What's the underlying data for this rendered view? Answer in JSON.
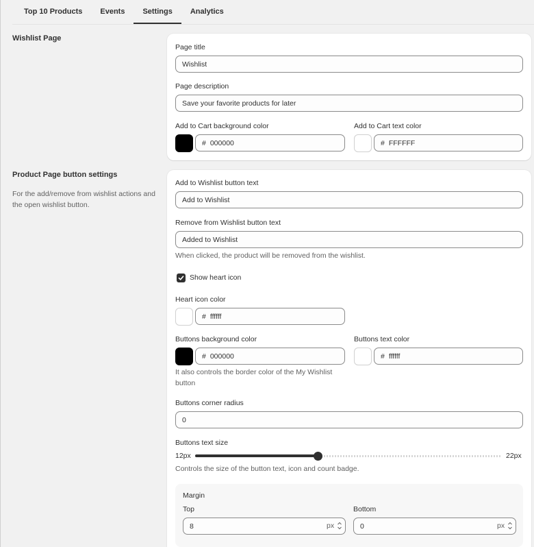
{
  "tabs": [
    {
      "label": "Top 10 Products"
    },
    {
      "label": "Events"
    },
    {
      "label": "Settings"
    },
    {
      "label": "Analytics"
    }
  ],
  "wishlist_page": {
    "title": "Wishlist Page",
    "page_title_label": "Page title",
    "page_title_value": "Wishlist",
    "page_desc_label": "Page description",
    "page_desc_value": "Save your favorite products for later",
    "cart_bg_label": "Add to Cart background color",
    "cart_bg_hash": "#",
    "cart_bg_value": "000000",
    "cart_text_label": "Add to Cart text color",
    "cart_text_hash": "#",
    "cart_text_value": "FFFFFF"
  },
  "product_page": {
    "title": "Product Page button settings",
    "description": "For the add/remove from wishlist actions and the open wishlist button.",
    "add_text_label": "Add to Wishlist button text",
    "add_text_value": "Add to Wishlist",
    "remove_text_label": "Remove from Wishlist button text",
    "remove_text_value": "Added to Wishlist",
    "remove_help": "When clicked, the product will be removed from the wishlist.",
    "show_heart_label": "Show heart icon",
    "show_heart_checked": true,
    "heart_color_label": "Heart icon color",
    "heart_color_hash": "#",
    "heart_color_value": "ffffff",
    "btn_bg_label": "Buttons background color",
    "btn_bg_hash": "#",
    "btn_bg_value": "000000",
    "btn_bg_help": "It also controls the border color of the My Wishlist button",
    "btn_text_label": "Buttons text color",
    "btn_text_hash": "#",
    "btn_text_value": "ffffff",
    "corner_label": "Buttons corner radius",
    "corner_value": "0",
    "text_size_label": "Buttons text size",
    "text_size_min": "12px",
    "text_size_max": "22px",
    "text_size_level": 0.4,
    "text_size_help": "Controls the size of the button text, icon and count badge.",
    "margin_label": "Margin",
    "top_label": "Top",
    "top_value": "8",
    "top_unit": "px",
    "bottom_label": "Bottom",
    "bottom_value": "0",
    "bottom_unit": "px"
  },
  "colors": {
    "accent": "#303030",
    "page_bg": "#f1f1f1",
    "card_bg": "#ffffff"
  }
}
